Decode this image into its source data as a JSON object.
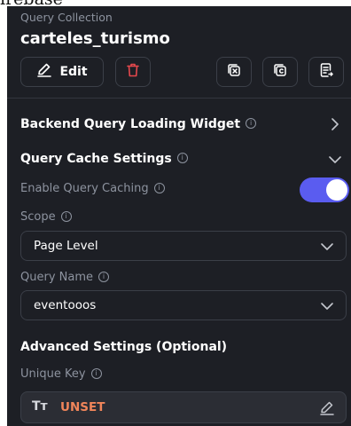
{
  "top_strip_text": "irebase",
  "collection": {
    "label": "Query Collection",
    "name": "carteles_turismo"
  },
  "toolbar": {
    "edit_label": "Edit",
    "icons": [
      "pencil-icon",
      "trash-icon",
      "clear-icon",
      "copy-icon",
      "export-icon"
    ]
  },
  "backend_widget": {
    "title": "Backend Query Loading Widget",
    "info": "i"
  },
  "cache": {
    "title": "Query Cache Settings",
    "info": "i",
    "enable_label": "Enable Query Caching",
    "enabled": true,
    "scope_label": "Scope",
    "scope_value": "Page Level",
    "query_name_label": "Query Name",
    "query_name_value": "eventooos"
  },
  "advanced": {
    "title": "Advanced Settings (Optional)",
    "unique_key_label": "Unique Key",
    "unique_key_prefix": "Tт",
    "unique_key_value": "UNSET"
  },
  "colors": {
    "panel_bg": "#1d1f25",
    "toggle_on": "#5a5cf0",
    "delete_red": "#e5484d",
    "unset_orange": "#f0855a"
  }
}
